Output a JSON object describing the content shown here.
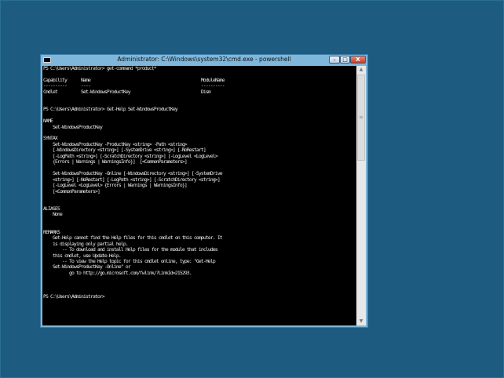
{
  "window": {
    "title": "Administrator: C:\\Windows\\system32\\cmd.exe - powershell",
    "minimize": "–",
    "maximize": "□",
    "close": "X"
  },
  "console": {
    "lines": [
      "PS C:\\Users\\Administrator> get-command *product*",
      "",
      "Capability      Name                                               ModuleName",
      "----------      ----                                               ----------",
      "Cmdlet          Set-WindowsProductKey                              Dism",
      "",
      "",
      "PS C:\\Users\\Administrator> Get-Help Set-WindowsProductKey",
      "",
      "NAME",
      "    Set-WindowsProductKey",
      "",
      "SYNTAX",
      "    Set-WindowsProductKey -ProductKey <string> -Path <string>",
      "    [-WindowsDirectory <string>] [-SystemDrive <string>] [-NoRestart]",
      "    [-LogPath <string>] [-ScratchDirectory <string>] [-LogLevel <LogLevel>",
      "    {Errors | Warnings | WarningsInfo}]  [<CommonParameters>]",
      "",
      "    Set-WindowsProductKey -Online [-WindowsDirectory <string>] [-SystemDrive",
      "    <string>] [-NoRestart] [-LogPath <string>] [-ScratchDirectory <string>]",
      "    [-LogLevel <LogLevel> {Errors | Warnings | WarningsInfo}]",
      "    [<CommonParameters>]",
      "",
      "",
      "ALIASES",
      "    None",
      "",
      "",
      "REMARKS",
      "    Get-Help cannot find the Help files for this cmdlet on this computer. It",
      "    is displaying only partial help.",
      "        -- To download and install Help files for the module that includes",
      "    this cmdlet, use Update-Help.",
      "        -- To view the Help topic for this cmdlet online, type: \"Get-Help",
      "    Set-WindowsProductKey -Online\" or",
      "           go to http://go.microsoft.com/fwlink/?LinkId=215293.",
      "",
      "",
      "",
      "PS C:\\Users\\Administrator>"
    ]
  },
  "scrollbar": {
    "up": "▲",
    "down": "▼",
    "grip": "≡"
  }
}
